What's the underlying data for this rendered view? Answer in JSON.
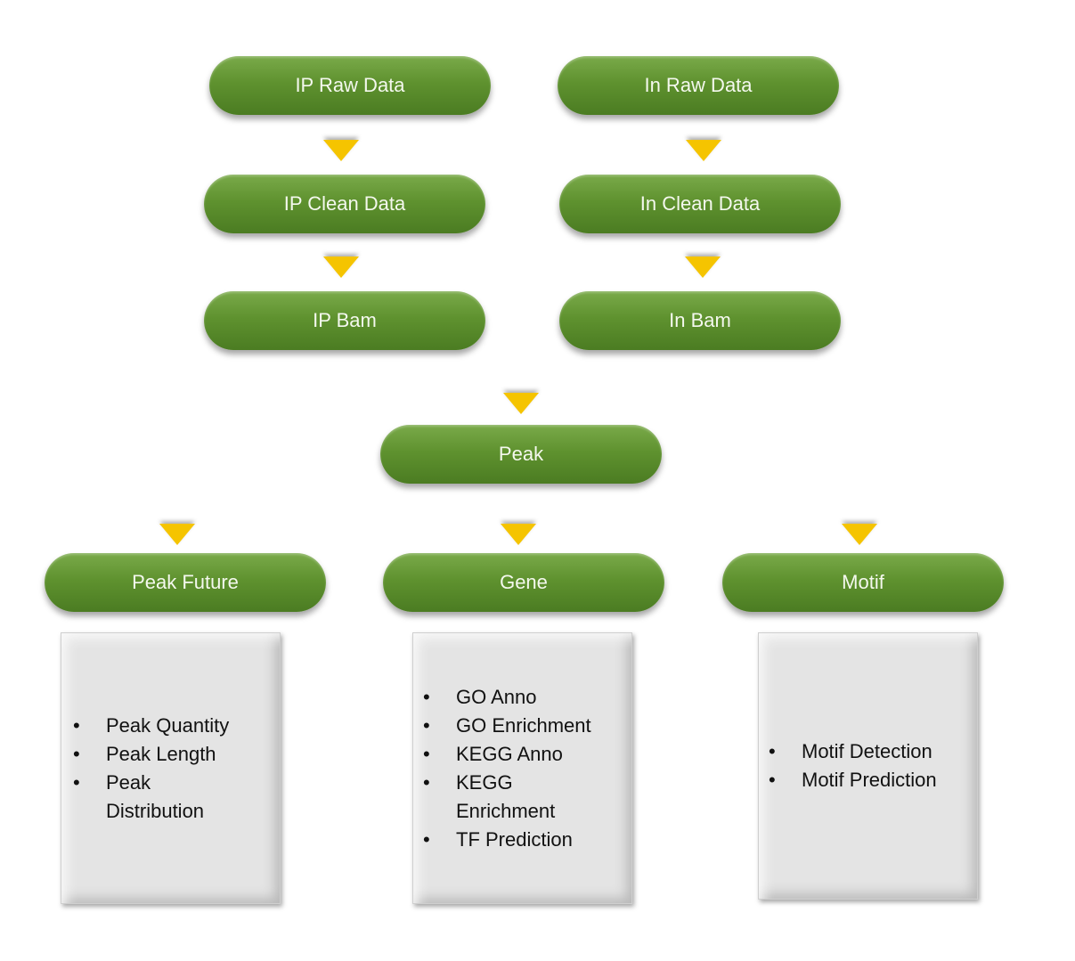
{
  "nodes": {
    "ip_raw": "IP Raw Data",
    "in_raw": "In Raw Data",
    "ip_clean": "IP Clean Data",
    "in_clean": "In Clean Data",
    "ip_bam": "IP Bam",
    "in_bam": "In Bam",
    "peak": "Peak",
    "peak_future": "Peak Future",
    "gene": "Gene",
    "motif": "Motif"
  },
  "lists": {
    "peak_future": [
      "Peak Quantity",
      "Peak Length",
      "Peak Distribution"
    ],
    "gene": [
      "GO Anno",
      "GO Enrichment",
      "KEGG Anno",
      "KEGG Enrichment",
      "TF Prediction"
    ],
    "motif": [
      "Motif Detection",
      "Motif Prediction"
    ]
  },
  "colors": {
    "node": "#5f922f",
    "arrow": "#f5c400",
    "box": "#e4e4e4"
  }
}
